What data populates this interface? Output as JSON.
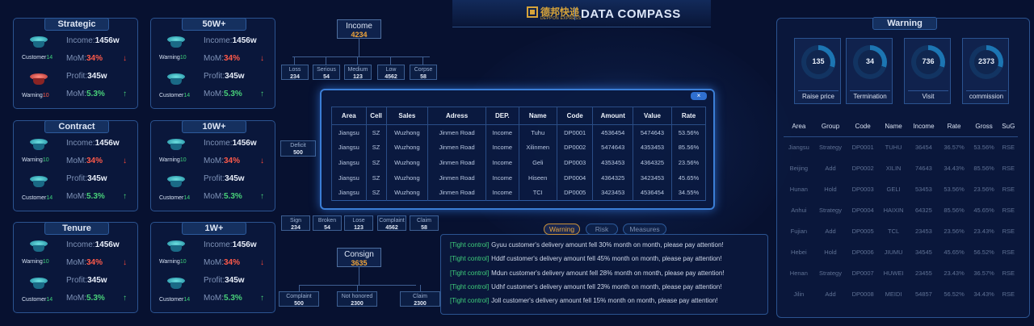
{
  "header": {
    "logo_cn": "德邦快递",
    "logo_en": "DEPPON EXPRESS",
    "title": "DATA COMPASS"
  },
  "left_panels": [
    {
      "title": "Strategic",
      "top": {
        "cup": "Customer",
        "num": "14"
      },
      "bottom": {
        "cup": "Warning",
        "num": "10",
        "red": true
      },
      "income_label": "Income:",
      "income": "1456w",
      "mom_label": "MoM:",
      "mom1": "34%",
      "profit_label": "Profit:",
      "profit": "345w",
      "mom2": "5.3%"
    },
    {
      "title": "50W+",
      "top": {
        "cup": "Warning",
        "num": "10"
      },
      "bottom": {
        "cup": "Customer",
        "num": "14"
      },
      "income_label": "Income:",
      "income": "1456w",
      "mom_label": "MoM:",
      "mom1": "34%",
      "profit_label": "Profit:",
      "profit": "345w",
      "mom2": "5.3%"
    },
    {
      "title": "Contract",
      "top": {
        "cup": "Warning",
        "num": "10"
      },
      "bottom": {
        "cup": "Customer",
        "num": "14"
      },
      "income_label": "Income:",
      "income": "1456w",
      "mom_label": "MoM:",
      "mom1": "34%",
      "profit_label": "Profit:",
      "profit": "345w",
      "mom2": "5.3%"
    },
    {
      "title": "10W+",
      "top": {
        "cup": "Warning",
        "num": "10"
      },
      "bottom": {
        "cup": "Customer",
        "num": "14"
      },
      "income_label": "Income:",
      "income": "1456w",
      "mom_label": "MoM:",
      "mom1": "34%",
      "profit_label": "Profit:",
      "profit": "345w",
      "mom2": "5.3%"
    },
    {
      "title": "Tenure",
      "top": {
        "cup": "Warning",
        "num": "10"
      },
      "bottom": {
        "cup": "Customer",
        "num": "14"
      },
      "income_label": "Income:",
      "income": "1456w",
      "mom_label": "MoM:",
      "mom1": "34%",
      "profit_label": "Profit:",
      "profit": "345w",
      "mom2": "5.3%"
    },
    {
      "title": "1W+",
      "top": {
        "cup": "Warning",
        "num": "10"
      },
      "bottom": {
        "cup": "Customer",
        "num": "14"
      },
      "income_label": "Income:",
      "income": "1456w",
      "mom_label": "MoM:",
      "mom1": "34%",
      "profit_label": "Profit:",
      "profit": "345w",
      "mom2": "5.3%"
    }
  ],
  "tree_top": {
    "root": {
      "label": "Income",
      "value": "4234"
    },
    "children": [
      {
        "label": "Loss",
        "value": "234"
      },
      {
        "label": "Serious",
        "value": "54"
      },
      {
        "label": "Medium",
        "value": "123"
      },
      {
        "label": "Low",
        "value": "4562"
      },
      {
        "label": "Corpse",
        "value": "58"
      }
    ],
    "deficit": {
      "label": "Deficit",
      "value": "500"
    }
  },
  "tree_bottom": {
    "row": [
      {
        "label": "Sign",
        "value": "234"
      },
      {
        "label": "Broken",
        "value": "54"
      },
      {
        "label": "Lose",
        "value": "123"
      },
      {
        "label": "Complaint",
        "value": "4562"
      },
      {
        "label": "Claim",
        "value": "58"
      }
    ],
    "root": {
      "label": "Consign",
      "value": "3635"
    },
    "children": [
      {
        "label": "Complaint",
        "value": "500"
      },
      {
        "label": "Not honored",
        "value": "2300"
      },
      {
        "label": "Claim",
        "value": "2300"
      }
    ]
  },
  "modal": {
    "close": "×",
    "columns": [
      "Area",
      "Cell",
      "Sales",
      "Adress",
      "DEP.",
      "Name",
      "Code",
      "Amount",
      "Value",
      "Rate"
    ],
    "rows": [
      [
        "Jiangsu",
        "SZ",
        "Wuzhong",
        "Jinmen Road",
        "Income",
        "Tuhu",
        "DP0001",
        "4536454",
        "5474643",
        "53.56%"
      ],
      [
        "Jiangsu",
        "SZ",
        "Wuzhong",
        "Jinmen Road",
        "Income",
        "Xilinmen",
        "DP0002",
        "5474643",
        "4353453",
        "85.56%"
      ],
      [
        "Jiangsu",
        "SZ",
        "Wuzhong",
        "Jinmen Road",
        "Income",
        "Geli",
        "DP0003",
        "4353453",
        "4364325",
        "23.56%"
      ],
      [
        "Jiangsu",
        "SZ",
        "Wuzhong",
        "Jinmen Road",
        "Income",
        "Hiseen",
        "DP0004",
        "4364325",
        "3423453",
        "45.65%"
      ],
      [
        "Jiangsu",
        "SZ",
        "Wuzhong",
        "Jinmen Road",
        "Income",
        "TCI",
        "DP0005",
        "3423453",
        "4536454",
        "34.55%"
      ]
    ]
  },
  "right": {
    "title": "Warning",
    "kpis": [
      {
        "value": "135",
        "label": "Raise price"
      },
      {
        "value": "34",
        "label": "Termination"
      },
      {
        "value": "736",
        "label": "Visit"
      },
      {
        "value": "2373",
        "label": "commission"
      }
    ],
    "columns": [
      "Area",
      "Group",
      "Code",
      "Name",
      "Income",
      "Rate",
      "Gross",
      "SuG"
    ],
    "rows": [
      [
        "Jiangsu",
        "Strategy",
        "DP0001",
        "TUHU",
        "36454",
        "36.57%",
        "53.56%",
        "RSE"
      ],
      [
        "Beijing",
        "Add",
        "DP0002",
        "XILIN",
        "74643",
        "34.43%",
        "85.56%",
        "RSE"
      ],
      [
        "Hunan",
        "Hold",
        "DP0003",
        "GELI",
        "53453",
        "53.56%",
        "23.56%",
        "RSE"
      ],
      [
        "Anhui",
        "Strategy",
        "DP0004",
        "HAIXIN",
        "64325",
        "85.56%",
        "45.65%",
        "RSE"
      ],
      [
        "Fujian",
        "Add",
        "DP0005",
        "TCL",
        "23453",
        "23.56%",
        "23.43%",
        "RSE"
      ],
      [
        "Hebei",
        "Hold",
        "DP0006",
        "JIUMU",
        "34545",
        "45.65%",
        "56.52%",
        "RSE"
      ],
      [
        "Henan",
        "Strategy",
        "DP0007",
        "HUWEI",
        "23455",
        "23.43%",
        "36.57%",
        "RSE"
      ],
      [
        "Jilin",
        "Add",
        "DP0008",
        "MEIDI",
        "54857",
        "56.52%",
        "34.43%",
        "RSE"
      ]
    ]
  },
  "bottom_tabs": [
    "Warning",
    "Risk",
    "Measures"
  ],
  "warnings": [
    {
      "tag": "[Tight control]",
      "text": "Gyuu customer's delivery amount fell 30% month on month, please pay attention!"
    },
    {
      "tag": "[Tight control]",
      "text": "Hddf customer's delivery amount fell 45% month on month, please pay attention!"
    },
    {
      "tag": "[Tight control]",
      "text": "Mdun customer's delivery amount fell 28% month on month, please pay attention!"
    },
    {
      "tag": "[Tight control]",
      "text": "Udhf customer's delivery amount fell 23% month on month, please pay attention!"
    },
    {
      "tag": "[Tight control]",
      "text": "Joll customer's delivery amount fell 15% month on month, please pay attention!"
    }
  ]
}
